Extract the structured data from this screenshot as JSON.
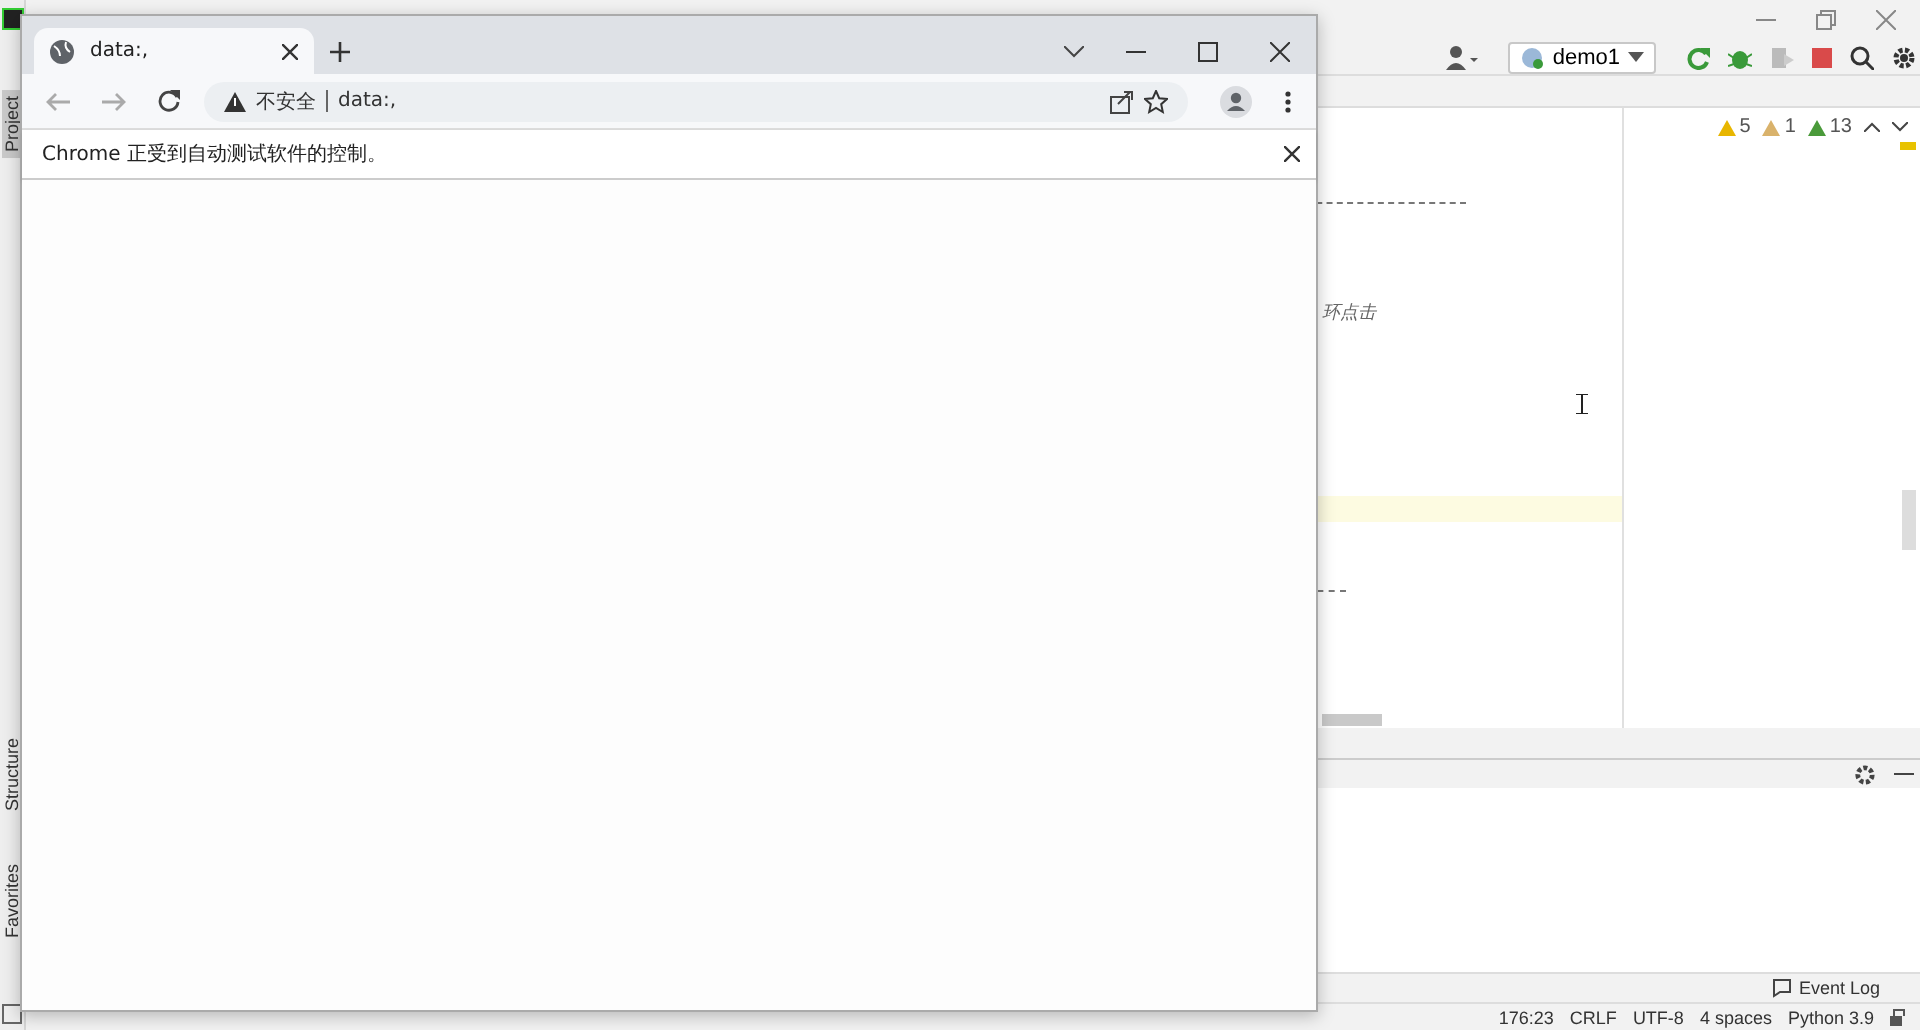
{
  "ide": {
    "project_tab": "Project",
    "structure_tab": "Structure",
    "favorites_tab": "Favorites",
    "run_config": "demo1",
    "inspections": [
      {
        "kind": "warning",
        "count": "5"
      },
      {
        "kind": "weak_warning",
        "count": "1"
      },
      {
        "kind": "typo",
        "count": "13"
      }
    ],
    "editor_fragment": "环点击",
    "event_log": "Event Log",
    "status": [
      "176:23",
      "CRLF",
      "UTF-8",
      "4 spaces",
      "Python 3.9"
    ]
  },
  "browser": {
    "tabs": [
      {
        "title": "data:,",
        "selected": true
      }
    ],
    "address": {
      "security": "不安全",
      "url": "data:,"
    },
    "infobar": "Chrome 正受到自动测试软件的控制。"
  }
}
